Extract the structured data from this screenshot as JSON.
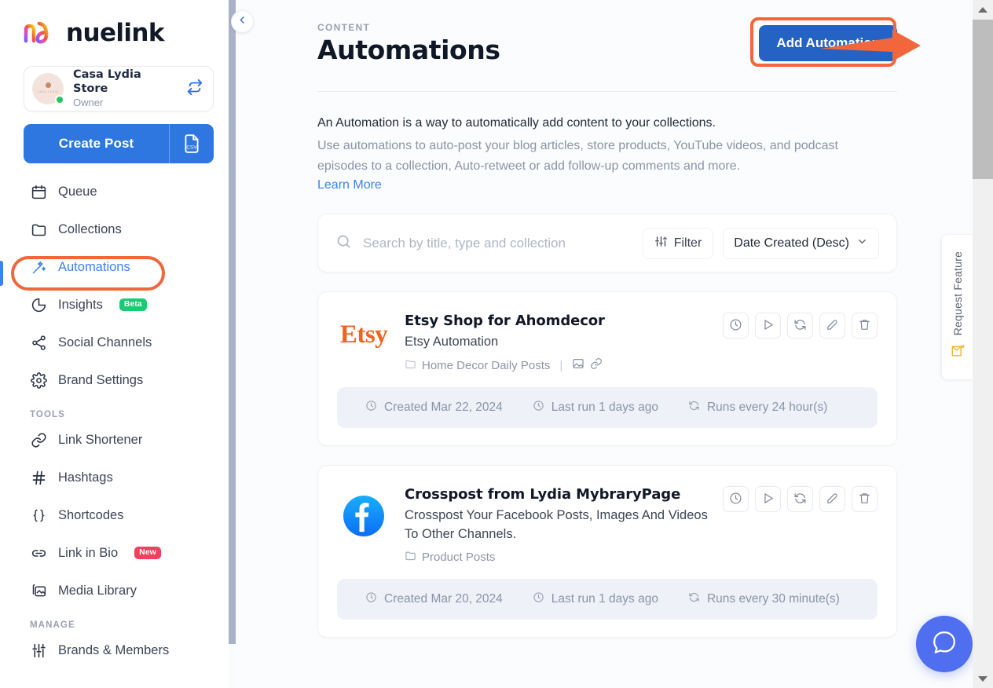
{
  "brand": {
    "logo_word": "nuelink",
    "account_name": "Casa Lydia Store",
    "account_role": "Owner",
    "switch_icon": "switch-accounts-icon"
  },
  "sidebar": {
    "create_post_label": "Create Post",
    "csv_icon": "csv-file-icon",
    "collapse_icon": "chevron-left-icon",
    "items": [
      {
        "label": "Queue",
        "icon": "calendar-icon",
        "active": false
      },
      {
        "label": "Collections",
        "icon": "folder-icon",
        "active": false
      },
      {
        "label": "Automations",
        "icon": "magic-wand-icon",
        "active": true
      },
      {
        "label": "Insights",
        "icon": "pie-chart-icon",
        "active": false,
        "badge": "Beta",
        "badge_type": "beta"
      },
      {
        "label": "Social Channels",
        "icon": "share-nodes-icon",
        "active": false
      },
      {
        "label": "Brand Settings",
        "icon": "gear-icon",
        "active": false
      }
    ],
    "tools_header": "TOOLS",
    "tools": [
      {
        "label": "Link Shortener",
        "icon": "link-icon"
      },
      {
        "label": "Hashtags",
        "icon": "hashtag-icon"
      },
      {
        "label": "Shortcodes",
        "icon": "braces-icon"
      },
      {
        "label": "Link in Bio",
        "icon": "chain-link-icon",
        "badge": "New",
        "badge_type": "new"
      },
      {
        "label": "Media Library",
        "icon": "images-icon"
      }
    ],
    "manage_header": "MANAGE",
    "manage": [
      {
        "label": "Brands & Members",
        "icon": "sliders-icon"
      }
    ]
  },
  "header": {
    "eyebrow": "CONTENT",
    "title": "Automations",
    "add_button": "Add Automation",
    "accent_highlight": "#f2663c",
    "button_color": "#2463c4"
  },
  "description": {
    "line1": "An Automation is a way to automatically add content to your collections.",
    "line2": "Use automations to auto-post your blog articles, store products, YouTube videos, and podcast episodes to a collection, Auto-retweet or add follow-up comments and more.",
    "learn_more": "Learn More"
  },
  "search": {
    "placeholder": "Search by title, type and collection",
    "value": "",
    "search_icon": "search-icon",
    "filter_label": "Filter",
    "filter_icon": "filter-sliders-icon",
    "sort_label": "Date Created (Desc)",
    "sort_icon": "chevron-down-icon"
  },
  "automations": [
    {
      "logo": "etsy-logo",
      "logo_text": "Etsy",
      "title": "Etsy Shop for Ahomdecor",
      "subtitle": "Etsy Automation",
      "collection": "Home Decor Daily Posts",
      "has_extra_icons": true,
      "extra_icons": [
        "image-icon",
        "link-icon"
      ],
      "created": "Created Mar 22, 2024",
      "last_run": "Last run 1 days ago",
      "frequency": "Runs every 24 hour(s)",
      "actions": [
        "history-clock-icon",
        "run-play-icon",
        "sync-refresh-icon",
        "edit-pencil-icon",
        "delete-trash-icon"
      ]
    },
    {
      "logo": "facebook-logo",
      "logo_text": "",
      "title": "Crosspost from Lydia MybraryPage",
      "subtitle": "Crosspost Your Facebook Posts, Images And Videos To Other Channels.",
      "collection": "Product Posts",
      "has_extra_icons": false,
      "extra_icons": [],
      "created": "Created Mar 20, 2024",
      "last_run": "Last run 1 days ago",
      "frequency": "Runs every 30 minute(s)",
      "actions": [
        "history-clock-icon",
        "run-play-icon",
        "sync-refresh-icon",
        "edit-pencil-icon",
        "delete-trash-icon"
      ]
    }
  ],
  "side_widgets": {
    "request_feature_label": "Request Feature",
    "request_feature_icon": "megaphone-send-icon",
    "help_icon": "chat-bubble-icon"
  }
}
